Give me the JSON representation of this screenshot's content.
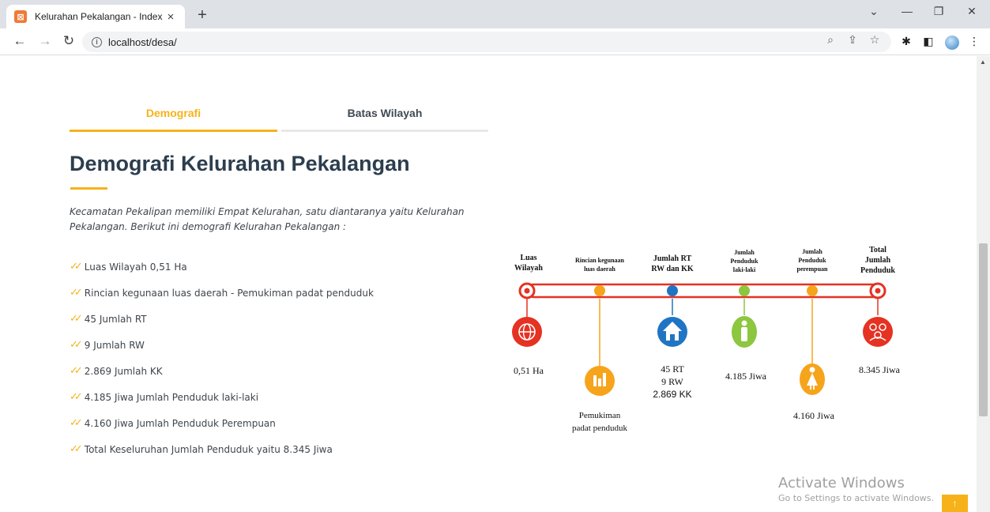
{
  "browser": {
    "tab_title": "Kelurahan Pekalangan - Index",
    "tab_close": "×",
    "new_tab": "+",
    "url": "localhost/desa/",
    "window_controls": {
      "menu": "⌄",
      "minimize": "—",
      "restore": "❐",
      "close": "✕"
    }
  },
  "page": {
    "tabs": [
      {
        "label": "Demografi",
        "active": true
      },
      {
        "label": "Batas Wilayah",
        "active": false
      }
    ],
    "heading": "Demografi Kelurahan Pekalangan",
    "intro": "Kecamatan Pekalipan memiliki Empat Kelurahan, satu diantaranya yaitu Kelurahan Pekalangan. Berikut ini demografi Kelurahan Pekalangan :",
    "facts": [
      "Luas Wilayah 0,51 Ha",
      "Rincian kegunaan luas daerah - Pemukiman padat penduduk",
      "45 Jumlah RT",
      "9 Jumlah RW",
      "2.869 Jumlah KK",
      "4.185 Jiwa Jumlah Penduduk laki-laki",
      "4.160 Jiwa Jumlah Penduduk Perempuan",
      "Total Keseluruhan Jumlah Penduduk yaitu 8.345 Jiwa"
    ],
    "accent_color": "#f7b21a"
  },
  "infographic": {
    "labels": {
      "luas_1": "Luas",
      "luas_2": "Wilayah",
      "rincian_1": "Rincian kegunaan",
      "rincian_2": "luas daerah",
      "rt_1": "Jumlah RT",
      "rt_2": "RW dan KK",
      "laki_1": "Jumlah",
      "laki_2": "Penduduk",
      "laki_3": "laki-laki",
      "perempuan_1": "Jumlah",
      "perempuan_2": "Penduduk",
      "perempuan_3": "perempuan",
      "total_1": "Total",
      "total_2": "Jumlah",
      "total_3": "Penduduk"
    },
    "values": {
      "luas": "0,51 Ha",
      "pemukiman_1": "Pemukiman",
      "pemukiman_2": "padat penduduk",
      "rt": "45 RT",
      "rw": "9 RW",
      "kk": "2.869 KK",
      "laki": "4.185 Jiwa",
      "perempuan": "4.160 Jiwa",
      "total": "8.345 Jiwa"
    },
    "colors": {
      "red": "#e53222",
      "orange": "#f6a41c",
      "blue": "#1f75c3",
      "green": "#8dc63f"
    }
  },
  "watermark": {
    "title": "Activate Windows",
    "subtitle": "Go to Settings to activate Windows."
  },
  "back_to_top": "↑"
}
